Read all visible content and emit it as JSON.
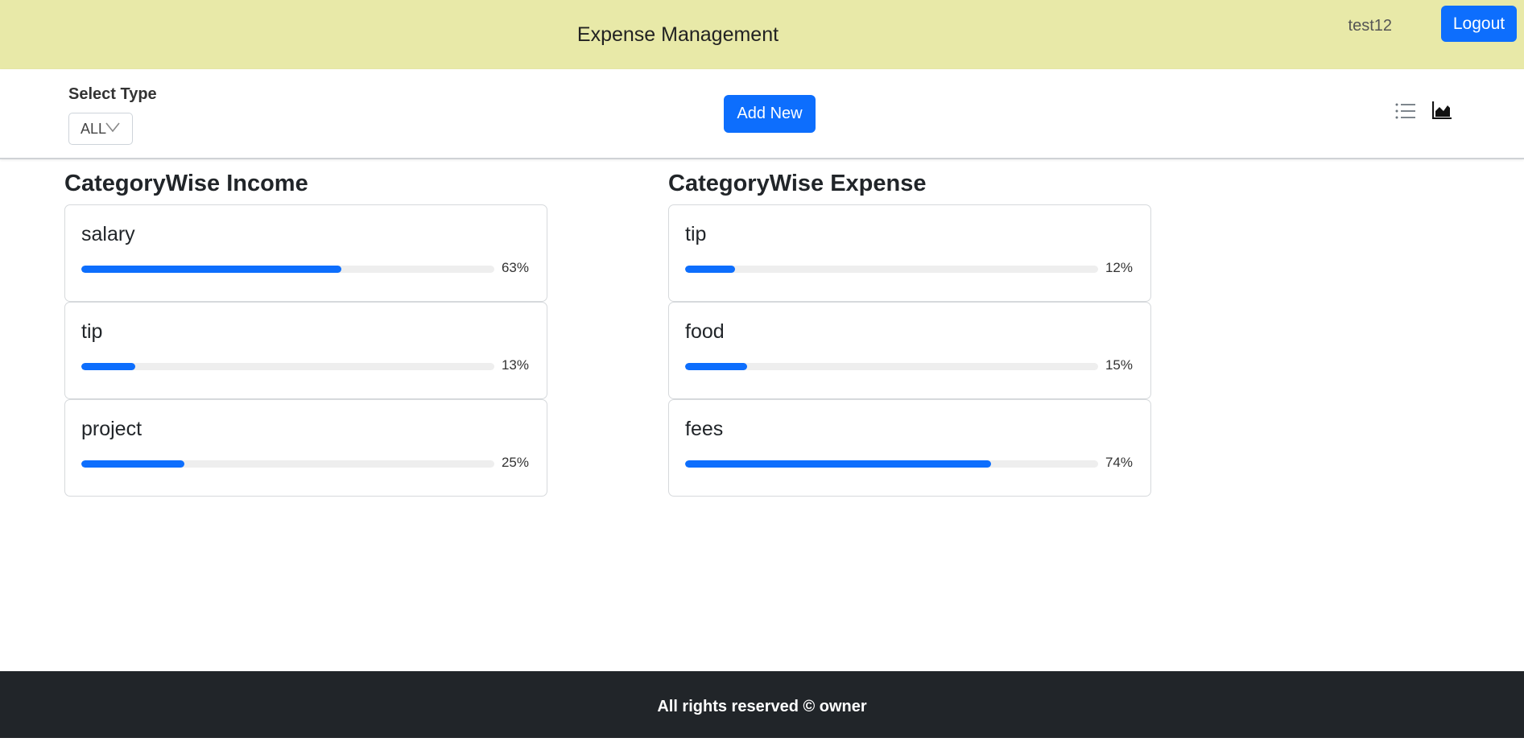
{
  "header": {
    "title": "Expense Management",
    "username": "test12",
    "logout_label": "Logout",
    "background": "#e8e9a8"
  },
  "toolbar": {
    "select_label": "Select Type",
    "select_value": "ALL",
    "add_label": "Add New",
    "icons": [
      "list-icon",
      "area-chart-icon"
    ]
  },
  "income": {
    "title": "CategoryWise Income",
    "items": [
      {
        "name": "salary",
        "percent_label": "63%",
        "percent": 63
      },
      {
        "name": "tip",
        "percent_label": "13%",
        "percent": 13
      },
      {
        "name": "project",
        "percent_label": "25%",
        "percent": 25
      }
    ]
  },
  "expense": {
    "title": "CategoryWise Expense",
    "items": [
      {
        "name": "tip",
        "percent_label": "12%",
        "percent": 12
      },
      {
        "name": "food",
        "percent_label": "15%",
        "percent": 15
      },
      {
        "name": "fees",
        "percent_label": "74%",
        "percent": 74
      }
    ]
  },
  "footer": {
    "text": "All rights reserved © owner"
  },
  "colors": {
    "accent": "#0d6efd",
    "footer_bg": "#212529"
  }
}
